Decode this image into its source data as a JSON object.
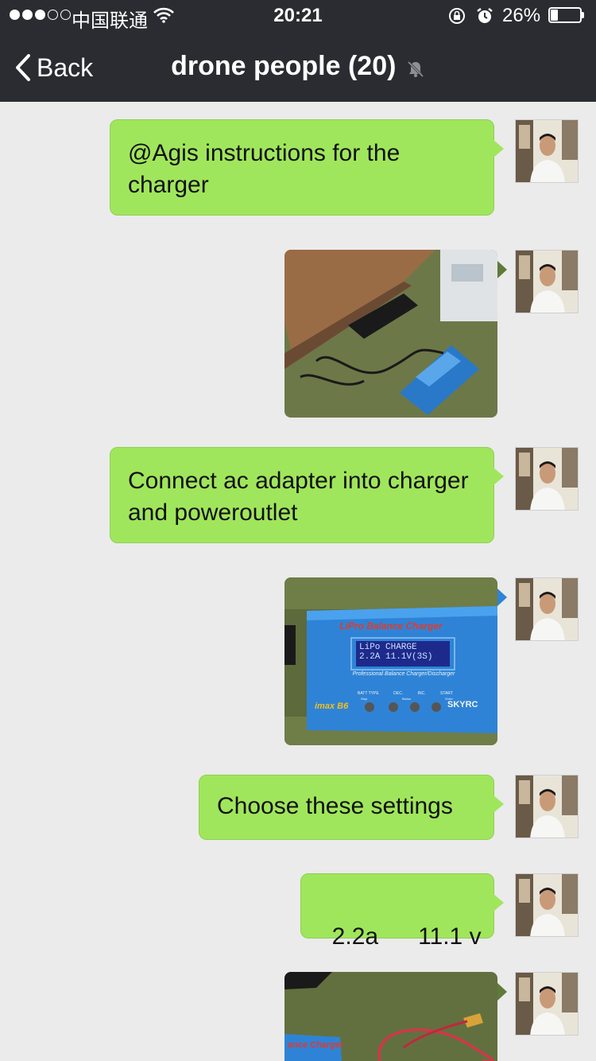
{
  "status_bar": {
    "carrier": "中国联通",
    "time": "20:21",
    "battery_percent": "26%",
    "battery_level": 0.26,
    "signal_bars_filled": 3,
    "signal_bars_total": 5
  },
  "nav": {
    "back_label": "Back",
    "title": "drone people (20)"
  },
  "colors": {
    "header_bg": "#2a2c31",
    "chat_bg": "#ebebeb",
    "bubble_green": "#a0e65c"
  },
  "messages": [
    {
      "type": "text",
      "text": "@Agis instructions for the charger"
    },
    {
      "type": "image",
      "description_icon": "photo-charger-adapter"
    },
    {
      "type": "text",
      "text": "Connect ac adapter into charger and poweroutlet"
    },
    {
      "type": "image",
      "description_icon": "photo-charger-screen",
      "device": {
        "brand": "LiPro Balance Charger",
        "screen_line1": "LiPo CHARGE",
        "screen_line2": "2.2A    11.1V(3S)",
        "subtitle": "Professional Balance Charger/Discharger",
        "model": "imax B6",
        "maker": "SKYRC",
        "buttons": [
          "BATT TYPE",
          "DEC.",
          "INC.",
          "START"
        ],
        "button_sub": [
          "Stop",
          "Status",
          "Enter"
        ]
      }
    },
    {
      "type": "text",
      "text": "Choose these settings"
    },
    {
      "type": "text",
      "text": "2.2a      11.1 v"
    },
    {
      "type": "image",
      "description_icon": "photo-charger-cable",
      "device": {
        "brand": "ance Charger"
      }
    }
  ]
}
